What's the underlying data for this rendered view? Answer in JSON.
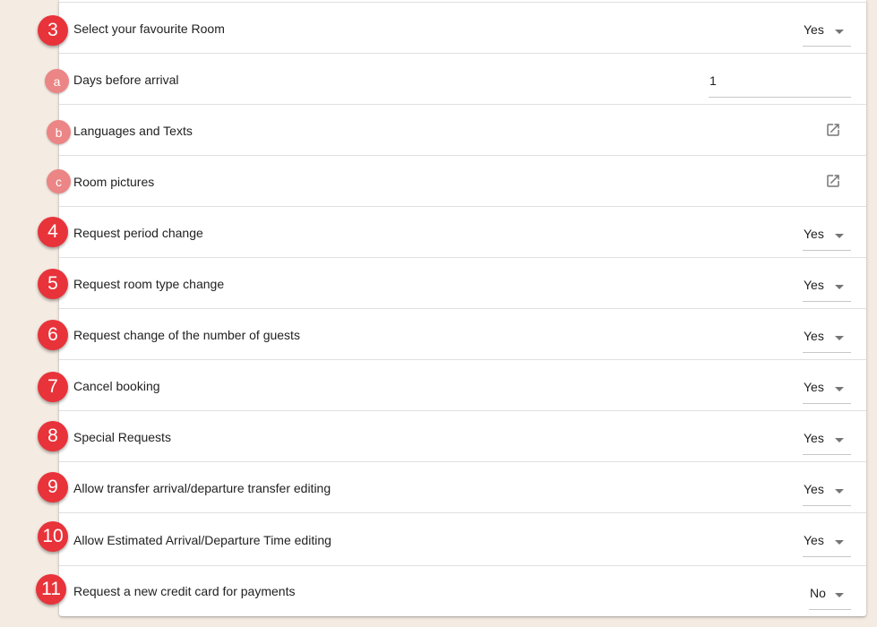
{
  "rows": [
    {
      "label": "Select your favourite Room",
      "value": "Yes",
      "marker": "3"
    },
    {
      "label": "Days before arrival",
      "value": "1",
      "marker": "a"
    },
    {
      "label": "Languages and Texts",
      "marker": "b",
      "icon": "open-in-new-icon"
    },
    {
      "label": "Room pictures",
      "marker": "c",
      "icon": "open-in-new-icon"
    },
    {
      "label": "Request period change",
      "value": "Yes",
      "marker": "4"
    },
    {
      "label": "Request room type change",
      "value": "Yes",
      "marker": "5"
    },
    {
      "label": "Request change of the number of guests",
      "value": "Yes",
      "marker": "6"
    },
    {
      "label": "Cancel booking",
      "value": "Yes",
      "marker": "7"
    },
    {
      "label": "Special Requests",
      "value": "Yes",
      "marker": "8"
    },
    {
      "label": "Allow transfer arrival/departure transfer editing",
      "value": "Yes",
      "marker": "9"
    },
    {
      "label": "Allow Estimated Arrival/Departure Time editing",
      "value": "Yes",
      "marker": "10"
    },
    {
      "label": "Request a new credit card for payments",
      "value": "No",
      "marker": "11"
    }
  ],
  "colors": {
    "background": "#f4ebe2",
    "numbered_marker": "#e8333a",
    "lettered_marker": "#ec8585",
    "divider": "#e0e0e0"
  }
}
